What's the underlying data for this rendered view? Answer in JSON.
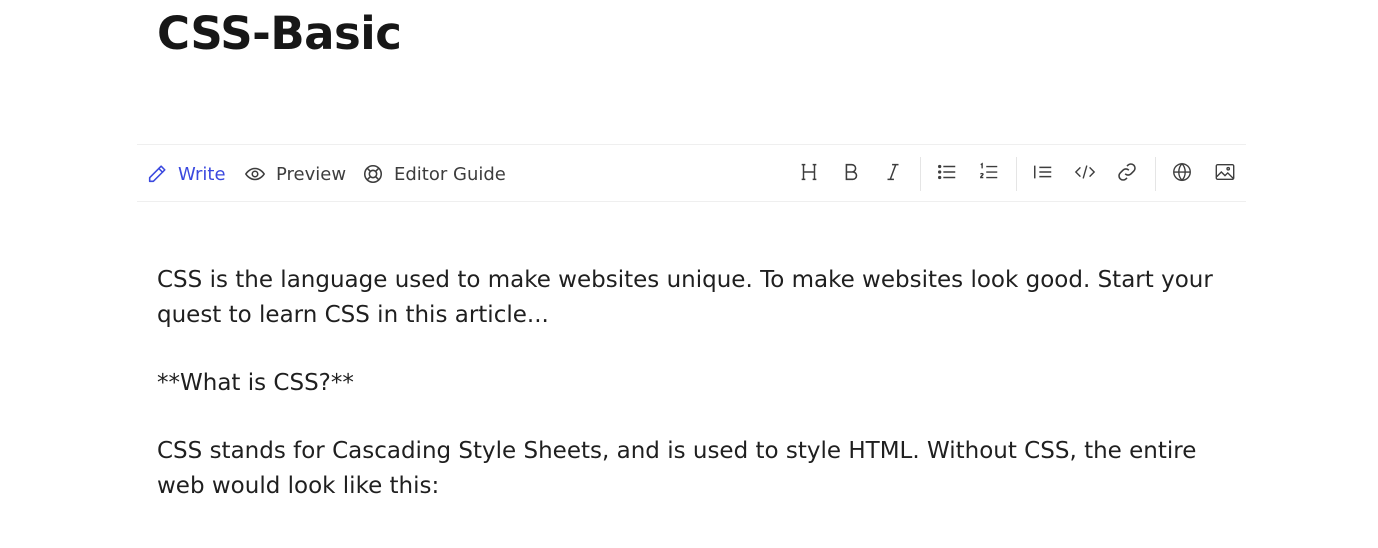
{
  "title": "CSS-Basic",
  "tabs": {
    "write": "Write",
    "preview": "Preview",
    "guide": "Editor Guide"
  },
  "toolbar": {
    "tools": [
      "heading-icon",
      "bold-icon",
      "italic-icon",
      "bulleted-list-icon",
      "numbered-list-icon",
      "quote-icon",
      "code-icon",
      "link-icon",
      "embed-icon",
      "image-icon"
    ]
  },
  "content": {
    "paragraph_1": "CSS is the language used to make websites unique. To make websites look good. Start your quest to learn CSS in this article...",
    "paragraph_2": "**What is CSS?**",
    "paragraph_3": "CSS stands for Cascading Style Sheets, and is used to style HTML. Without CSS, the entire web would look like this:"
  },
  "colors": {
    "accent": "#3b49df",
    "text": "#171717"
  }
}
